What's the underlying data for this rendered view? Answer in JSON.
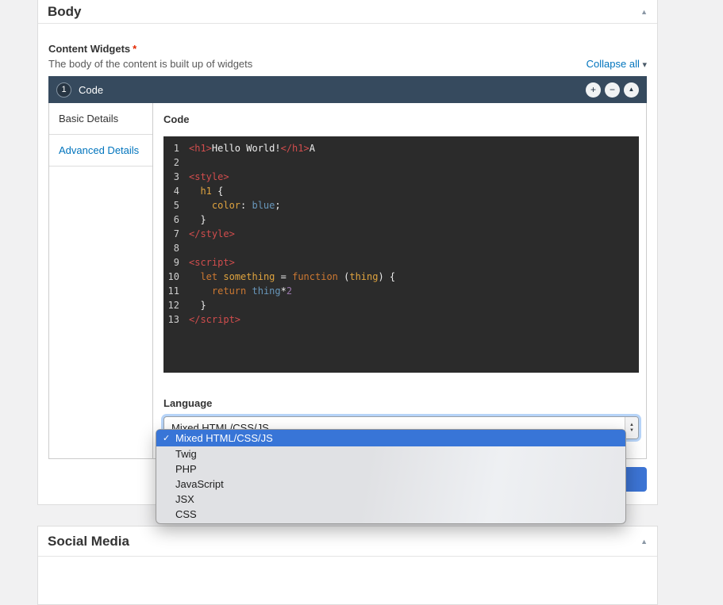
{
  "colors": {
    "accent_blue": "#0074bd",
    "widget_header": "#364a5e",
    "editor_bg": "#2b2b2b",
    "select_highlight": "#3875d7",
    "primary_button": "#3c74d4",
    "required_red": "#e32700",
    "token_tag": "#d14d4d",
    "token_keyword": "#cc7832",
    "token_ident": "#dfa33f",
    "token_value": "#6897bb",
    "token_number": "#9876aa"
  },
  "body_section": {
    "title": "Body",
    "collapse_icon": "▲",
    "field": {
      "label": "Content Widgets",
      "required_marker": "*",
      "description": "The body of the content is built up of widgets",
      "collapse_all_label": "Collapse all",
      "collapse_all_caret": "▾"
    }
  },
  "widget": {
    "number": "1",
    "title": "Code",
    "header_buttons": [
      {
        "name": "add",
        "glyph": "+"
      },
      {
        "name": "remove",
        "glyph": "−"
      },
      {
        "name": "collapse",
        "glyph": "▲"
      }
    ],
    "tabs": [
      {
        "label": "Basic Details"
      },
      {
        "label": "Advanced Details"
      }
    ],
    "code_field": {
      "label": "Code",
      "lines": [
        {
          "num": 1,
          "tokens": [
            {
              "t": "tag",
              "x": "<h1>"
            },
            {
              "t": "plain",
              "x": "Hello World!"
            },
            {
              "t": "tag",
              "x": "</h1>"
            },
            {
              "t": "plain",
              "x": "A"
            }
          ]
        },
        {
          "num": 2,
          "tokens": []
        },
        {
          "num": 3,
          "tokens": [
            {
              "t": "tag",
              "x": "<style>"
            }
          ]
        },
        {
          "num": 4,
          "tokens": [
            {
              "t": "plain",
              "x": "  "
            },
            {
              "t": "ident",
              "x": "h1"
            },
            {
              "t": "plain",
              "x": " {"
            }
          ]
        },
        {
          "num": 5,
          "tokens": [
            {
              "t": "plain",
              "x": "    "
            },
            {
              "t": "ident",
              "x": "color"
            },
            {
              "t": "plain",
              "x": ": "
            },
            {
              "t": "value",
              "x": "blue"
            },
            {
              "t": "plain",
              "x": ";"
            }
          ]
        },
        {
          "num": 6,
          "tokens": [
            {
              "t": "plain",
              "x": "  }"
            }
          ]
        },
        {
          "num": 7,
          "tokens": [
            {
              "t": "tag",
              "x": "</style>"
            }
          ]
        },
        {
          "num": 8,
          "tokens": []
        },
        {
          "num": 9,
          "tokens": [
            {
              "t": "tag",
              "x": "<script>"
            }
          ]
        },
        {
          "num": 10,
          "tokens": [
            {
              "t": "plain",
              "x": "  "
            },
            {
              "t": "keyword",
              "x": "let"
            },
            {
              "t": "plain",
              "x": " "
            },
            {
              "t": "ident",
              "x": "something"
            },
            {
              "t": "plain",
              "x": " = "
            },
            {
              "t": "keyword",
              "x": "function"
            },
            {
              "t": "plain",
              "x": " ("
            },
            {
              "t": "ident",
              "x": "thing"
            },
            {
              "t": "plain",
              "x": ") {"
            }
          ]
        },
        {
          "num": 11,
          "tokens": [
            {
              "t": "plain",
              "x": "    "
            },
            {
              "t": "keyword",
              "x": "return"
            },
            {
              "t": "plain",
              "x": " "
            },
            {
              "t": "value",
              "x": "thing"
            },
            {
              "t": "plain",
              "x": "*"
            },
            {
              "t": "number",
              "x": "2"
            }
          ]
        },
        {
          "num": 12,
          "tokens": [
            {
              "t": "plain",
              "x": "  }"
            }
          ]
        },
        {
          "num": 13,
          "tokens": [
            {
              "t": "tag",
              "x": "</script>"
            }
          ]
        }
      ]
    },
    "language_field": {
      "label": "Language",
      "value": "Mixed HTML/CSS/JS",
      "selected_index": 0,
      "checkmark": "✓",
      "stepper_up": "▲",
      "stepper_down": "▼",
      "options": [
        "Mixed HTML/CSS/JS",
        "Twig",
        "PHP",
        "JavaScript",
        "JSX",
        "CSS"
      ]
    },
    "primary_button_label": ""
  },
  "social_section": {
    "title": "Social Media",
    "collapse_icon": "▲"
  }
}
